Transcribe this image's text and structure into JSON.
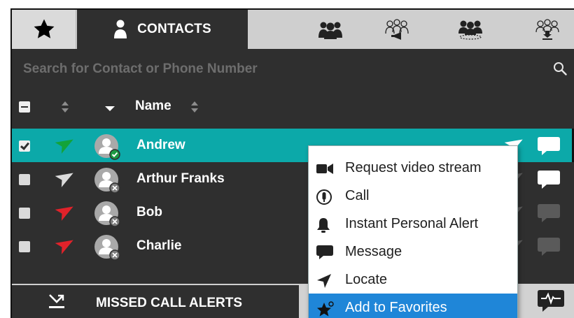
{
  "tabs": {
    "favorites_icon": "star-icon",
    "contacts_label": "CONTACTS",
    "groups_icon": "groups-icon",
    "broadcast_icon": "broadcast-group-icon",
    "conference_icon": "conference-group-icon",
    "download_icon": "download-group-icon"
  },
  "search": {
    "placeholder": "Search for Contact or Phone Number",
    "value": ""
  },
  "header": {
    "name_label": "Name"
  },
  "contacts": [
    {
      "name": "Andrew",
      "selected": true,
      "checked": true,
      "location_color": "#13a33a",
      "status": "online"
    },
    {
      "name": "Arthur Franks",
      "selected": false,
      "checked": false,
      "location_color": "#dcdcdc",
      "status": "offline"
    },
    {
      "name": "Bob",
      "selected": false,
      "checked": false,
      "location_color": "#e0222a",
      "status": "offline"
    },
    {
      "name": "Charlie",
      "selected": false,
      "checked": false,
      "location_color": "#e0222a",
      "status": "offline"
    }
  ],
  "context_menu": {
    "items": [
      {
        "label": "Request video stream",
        "icon": "video-camera-icon"
      },
      {
        "label": "Call",
        "icon": "call-icon"
      },
      {
        "label": "Instant Personal Alert",
        "icon": "bell-alert-icon"
      },
      {
        "label": "Message",
        "icon": "message-icon"
      },
      {
        "label": "Locate",
        "icon": "locate-arrow-icon"
      },
      {
        "label": "Add to Favorites",
        "icon": "star-add-icon",
        "active": true
      }
    ]
  },
  "footer": {
    "missed_calls_label": "MISSED CALL ALERTS",
    "activity_icon": "activity-chat-icon"
  },
  "colors": {
    "accent_teal": "#0ca9a9",
    "menu_highlight": "#1f86d8",
    "panel_bg": "#2f2f2f",
    "tab_bg": "#cfcfcf"
  }
}
